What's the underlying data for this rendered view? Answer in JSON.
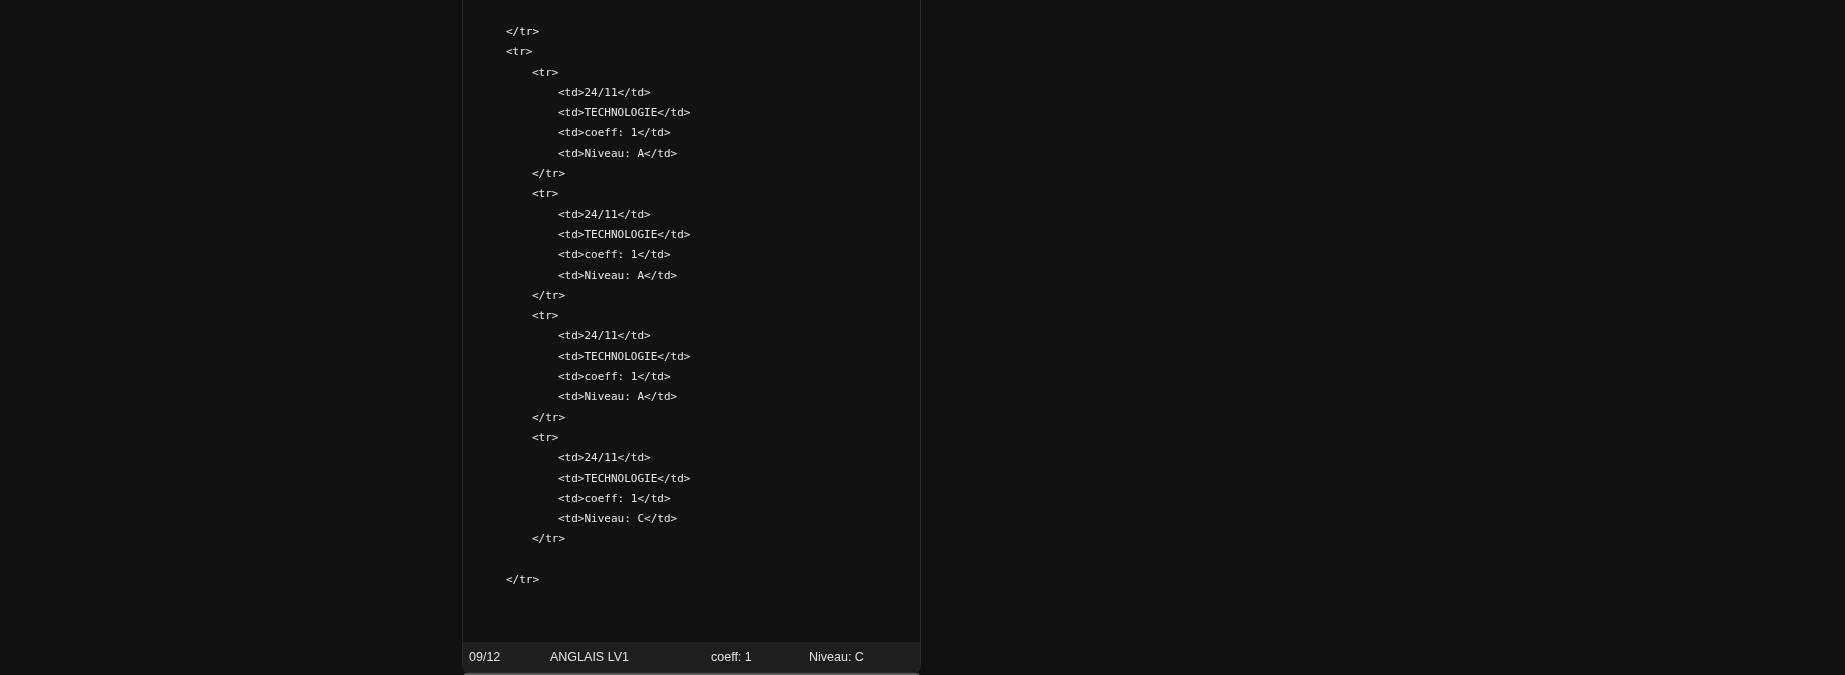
{
  "code_lines": [
    {
      "text": "</tr>"
    },
    {
      "text": "<tr>",
      "children": [
        {
          "text": "<tr>",
          "children": [
            {
              "text": "<td>24/11</td>"
            },
            {
              "text": "<td>TECHNOLOGIE</td>"
            },
            {
              "text": "<td>coeff: 1</td>"
            },
            {
              "text": "<td>Niveau: A</td>"
            }
          ]
        },
        {
          "text": "</tr>"
        },
        {
          "text": "<tr>",
          "children": [
            {
              "text": "<td>24/11</td>"
            },
            {
              "text": "<td>TECHNOLOGIE</td>"
            },
            {
              "text": "<td>coeff: 1</td>"
            },
            {
              "text": "<td>Niveau: A</td>"
            }
          ]
        },
        {
          "text": "</tr>"
        },
        {
          "text": "<tr>",
          "children": [
            {
              "text": "<td>24/11</td>"
            },
            {
              "text": "<td>TECHNOLOGIE</td>"
            },
            {
              "text": "<td>coeff: 1</td>"
            },
            {
              "text": "<td>Niveau: A</td>"
            }
          ]
        },
        {
          "text": "</tr>"
        },
        {
          "text": "<tr>",
          "children": [
            {
              "text": "<td>24/11</td>"
            },
            {
              "text": "<td>TECHNOLOGIE</td>"
            },
            {
              "text": "<td>coeff: 1</td>"
            },
            {
              "text": "<td>Niveau: C</td>"
            }
          ]
        },
        {
          "text": "</tr>"
        }
      ]
    },
    {
      "text": "</tr>"
    }
  ],
  "grade_row": {
    "date": "09/12",
    "subject": "ANGLAIS LV1",
    "coefficient": "coeff: 1",
    "level": "Niveau: C"
  }
}
